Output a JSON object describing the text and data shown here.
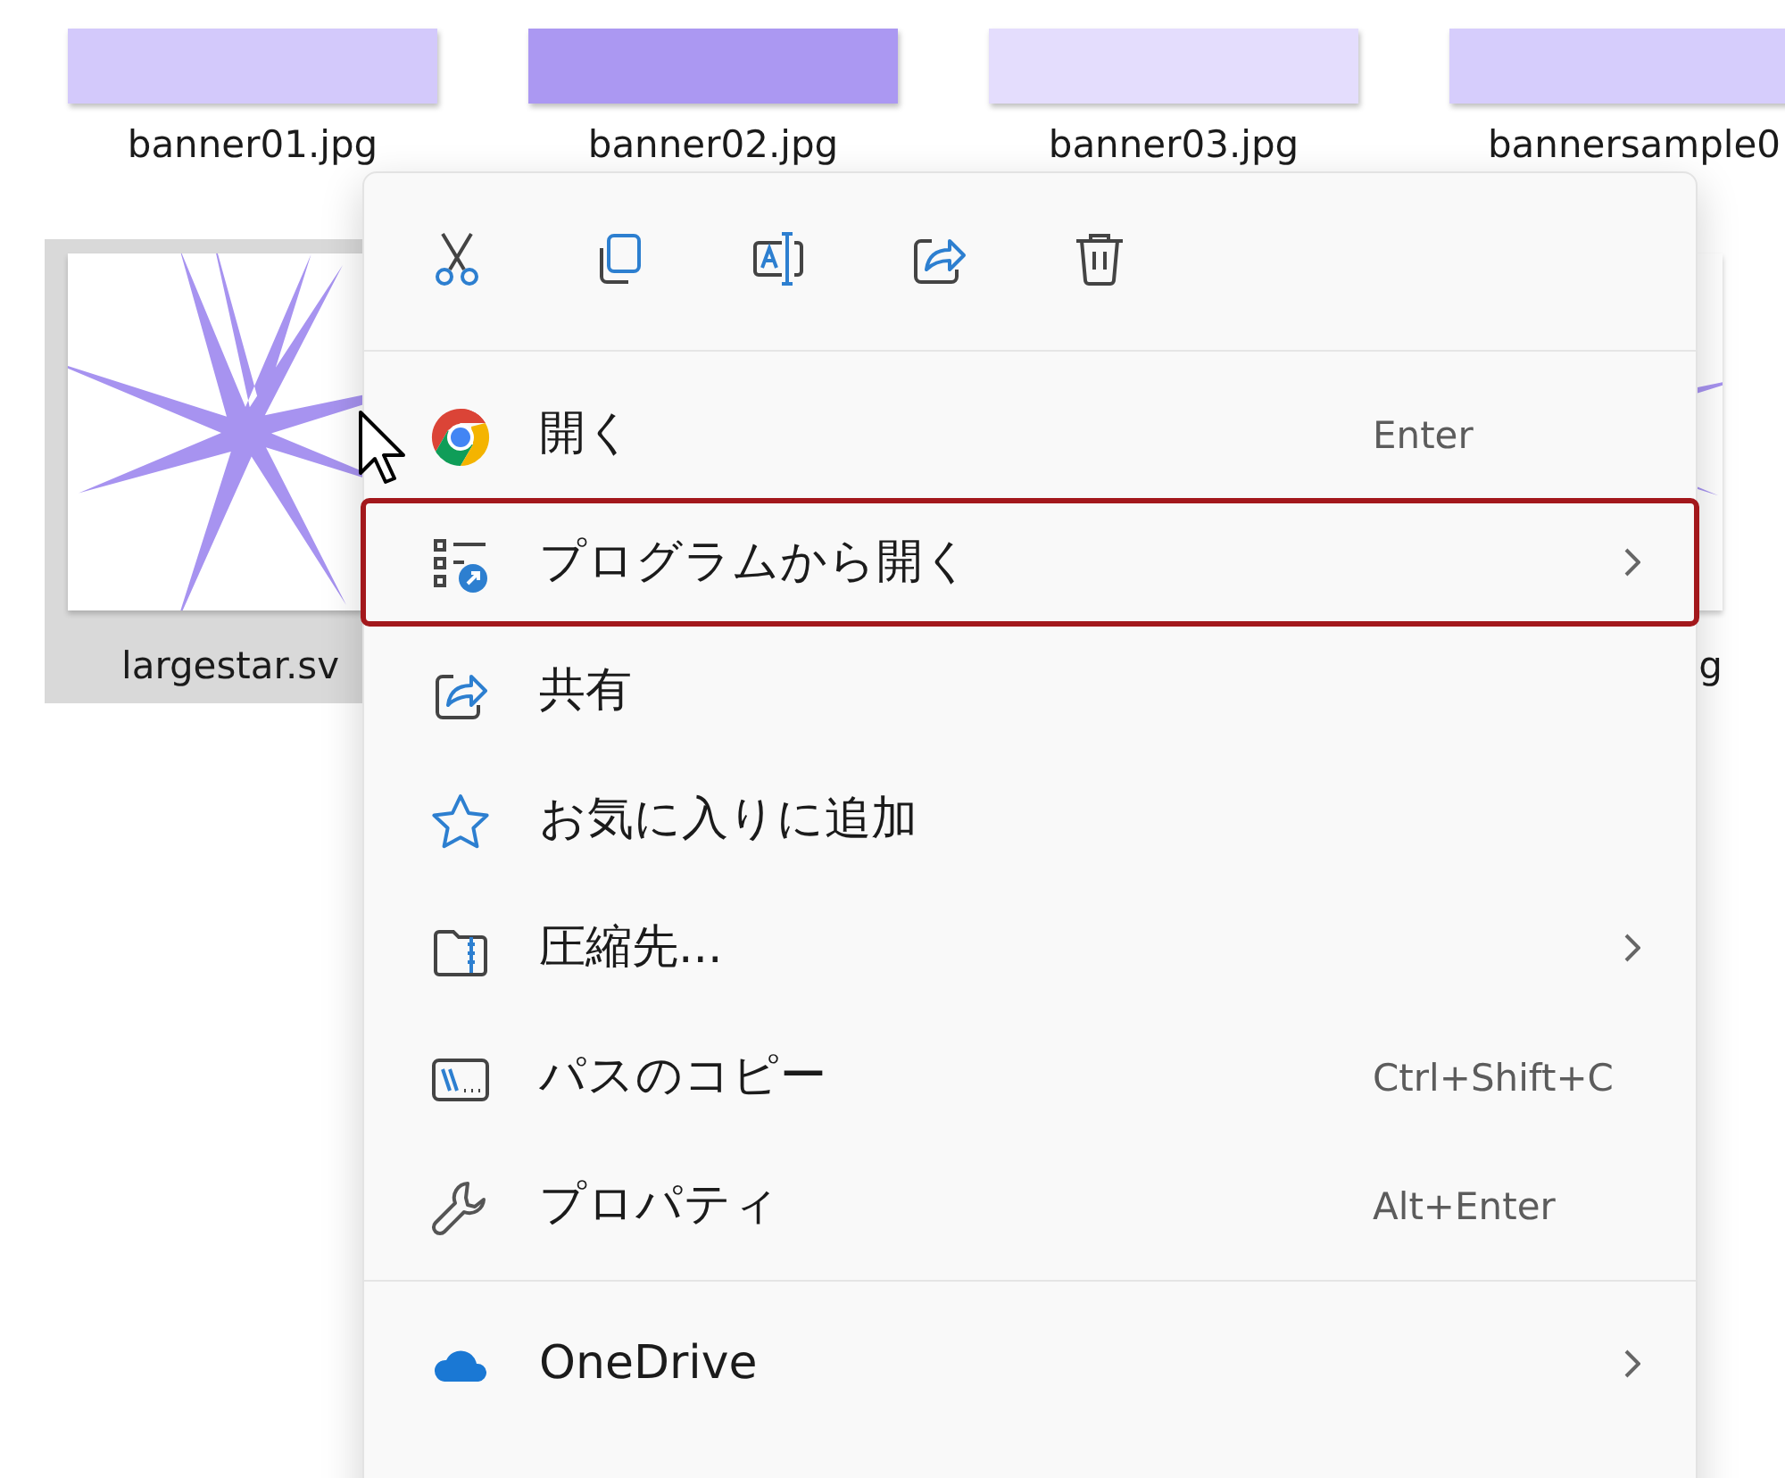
{
  "files_row_1": [
    {
      "name": "banner01.jpg",
      "color": "#d3c9fb"
    },
    {
      "name": "banner02.jpg",
      "color": "#ab98f2"
    },
    {
      "name": "banner03.jpg",
      "color": "#e4ddfd"
    },
    {
      "name": "bannersample0",
      "color": "#d6cdfc"
    }
  ],
  "files_row_2": [
    {
      "name": "largestar.sv",
      "selected": true
    },
    {
      "name": "g",
      "selected": false
    }
  ],
  "context_menu": {
    "toolbar": [
      {
        "kind": "cut"
      },
      {
        "kind": "copy"
      },
      {
        "kind": "rename"
      },
      {
        "kind": "share"
      },
      {
        "kind": "delete"
      }
    ],
    "groups": [
      [
        {
          "kind": "chrome",
          "label": "開く",
          "shortcut": "Enter",
          "submenu": false,
          "highlighted": false
        },
        {
          "kind": "openwith",
          "label": "プログラムから開く",
          "submenu": true,
          "highlighted": true
        },
        {
          "kind": "share",
          "label": "共有",
          "submenu": false,
          "highlighted": false
        },
        {
          "kind": "star",
          "label": "お気に入りに追加",
          "submenu": false,
          "highlighted": false
        },
        {
          "kind": "zip",
          "label": "圧縮先...",
          "submenu": true,
          "highlighted": false
        },
        {
          "kind": "path",
          "label": "パスのコピー",
          "shortcut": "Ctrl+Shift+C",
          "submenu": false,
          "highlighted": false
        },
        {
          "kind": "wrench",
          "label": "プロパティ",
          "shortcut": "Alt+Enter",
          "submenu": false,
          "highlighted": false
        }
      ],
      [
        {
          "kind": "onedrive",
          "label": "OneDrive",
          "submenu": true,
          "highlighted": false
        }
      ]
    ]
  }
}
